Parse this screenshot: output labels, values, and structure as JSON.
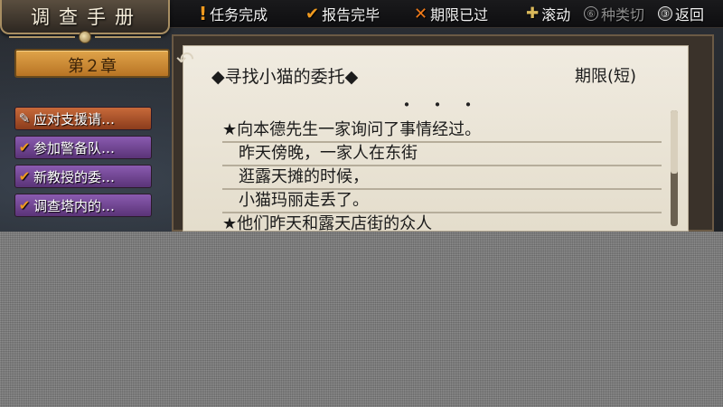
{
  "header": {
    "book_title": "调查手册",
    "chapter": "第２章"
  },
  "legend": {
    "task_complete": "任务完成",
    "report_done": "报告完毕",
    "deadline_passed": "期限已过",
    "scroll": "滚动",
    "switch_category_num": "⑥",
    "switch_category": "种类切",
    "back_num": "③",
    "back": "返回"
  },
  "quests": [
    {
      "status_icon": "pencil-icon",
      "label": "应对支援请…",
      "color": "#c86a3a"
    },
    {
      "status_icon": "check-icon",
      "label": "参加警备队…",
      "color": "#8a5bb0"
    },
    {
      "status_icon": "check-icon",
      "label": "新教授的委…",
      "color": "#8a5bb0"
    },
    {
      "status_icon": "check-icon",
      "label": "调查塔内的…",
      "color": "#8a5bb0"
    }
  ],
  "detail": {
    "title": "◆寻找小猫的委托◆",
    "deadline": "期限(短)",
    "separator": "・・・",
    "lines": [
      "★向本德先生一家询问了事情经过。",
      "　昨天傍晚，一家人在东街",
      "　逛露天摊的时候，",
      "　小猫玛丽走丢了。",
      "★他们昨天和露天店街的众人"
    ]
  },
  "colors": {
    "accent_orange": "#f09a1f",
    "quest_orange": "#c86a3a",
    "quest_purple": "#8a5bb0",
    "paper": "#f0ebe0"
  }
}
